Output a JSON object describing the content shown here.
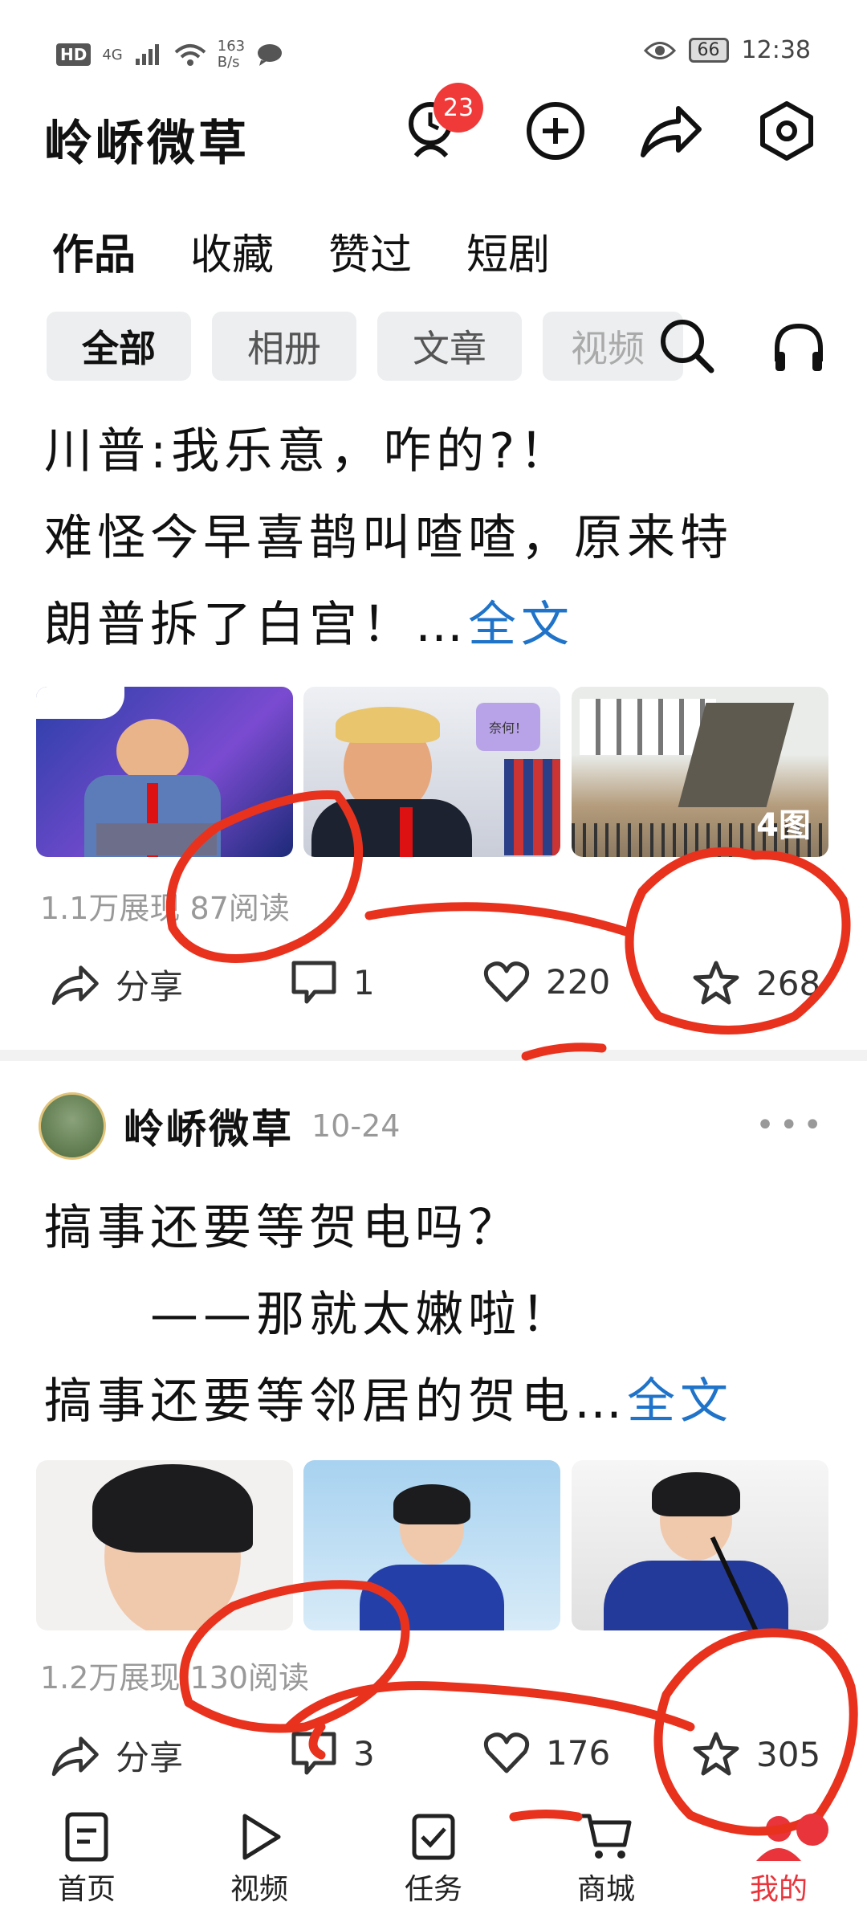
{
  "status_bar": {
    "network": "HD",
    "signal": "4G",
    "speed": "163\nB/s",
    "battery": "66",
    "time": "12:38"
  },
  "header": {
    "title": "岭峤微草",
    "notification_count": "23"
  },
  "tabs": [
    "作品",
    "收藏",
    "赞过",
    "短剧"
  ],
  "chips": [
    "全部",
    "相册",
    "文章",
    "视频"
  ],
  "posts": [
    {
      "lines": [
        "川普:我乐意，咋的?！",
        "难怪今早喜鹊叫喳喳，原来特",
        "朗普拆了白宫！…"
      ],
      "more": "全文",
      "image_count": "4图",
      "bubble_text": "奈何！",
      "stats": "1.1万展现  87阅读",
      "share": "分享",
      "comments": "1",
      "likes": "220",
      "favorites": "268"
    },
    {
      "author": "岭峤微草",
      "date": "10-24",
      "lines": [
        "搞事还要等贺电吗？",
        "　　——那就太嫩啦！",
        "搞事还要等邻居的贺电…"
      ],
      "more": "全文",
      "stats": "1.2万展现  130阅读",
      "share": "分享",
      "comments": "3",
      "likes": "176",
      "favorites": "305"
    }
  ],
  "bottom_nav": [
    {
      "label": "首页",
      "icon": "home-doc-icon"
    },
    {
      "label": "视频",
      "icon": "play-icon"
    },
    {
      "label": "任务",
      "icon": "check-box-icon"
    },
    {
      "label": "商城",
      "icon": "cart-icon"
    },
    {
      "label": "我的",
      "icon": "profile-icon"
    }
  ],
  "colors": {
    "accent": "#e8343a",
    "link": "#1f73c9",
    "annotation": "#e8321e"
  }
}
